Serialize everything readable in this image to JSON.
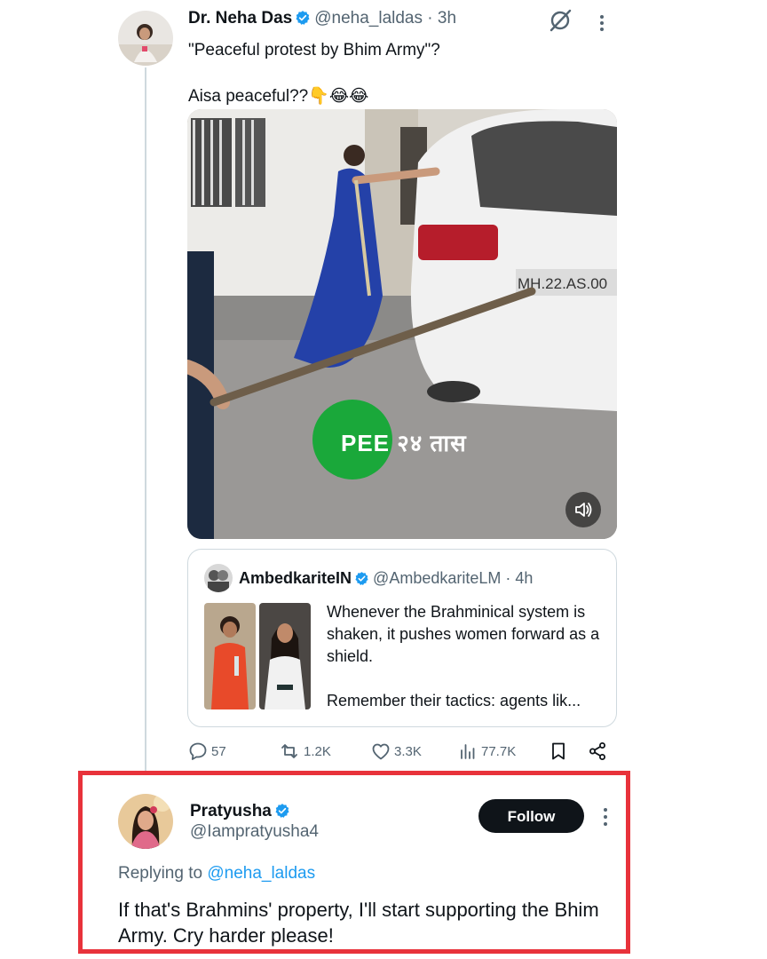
{
  "tweet": {
    "author_name": "Dr. Neha Das",
    "author_handle": "@neha_laldas",
    "dot": "·",
    "time": "3h",
    "text": "\"Peaceful protest by Bhim Army\"?\n\nAisa peaceful??👇😂😂",
    "media_overlay": "PEE २४ तास",
    "plate_text": "MH.22.AS.00"
  },
  "quoted": {
    "author_name": "AmbedkariteIN",
    "author_handle": "@AmbedkariteLM",
    "dot": "·",
    "time": "4h",
    "text_line1": "Whenever the  Brahminical system is shaken, it pushes women forward as a shield.",
    "text_line2": "Remember their tactics: agents lik..."
  },
  "actions": {
    "replies": "57",
    "reposts": "1.2K",
    "likes": "3.3K",
    "views": "77.7K"
  },
  "reply": {
    "author_name": "Pratyusha",
    "author_handle": "@Iampratyusha4",
    "follow_label": "Follow",
    "replying_prefix": "Replying to",
    "replying_mention": "@neha_laldas",
    "text": "If that's Brahmins' property, I'll start supporting the Bhim Army. Cry harder please!"
  },
  "colors": {
    "verified": "#1d9bf0",
    "highlight_border": "#e8323b",
    "secondary_text": "#536471",
    "thread_line": "#cfd9de"
  },
  "icons": [
    "verified-badge-icon",
    "grok-icon",
    "more-icon",
    "mute-icon",
    "reply-icon",
    "repost-icon",
    "like-icon",
    "views-icon",
    "bookmark-icon",
    "share-icon"
  ]
}
